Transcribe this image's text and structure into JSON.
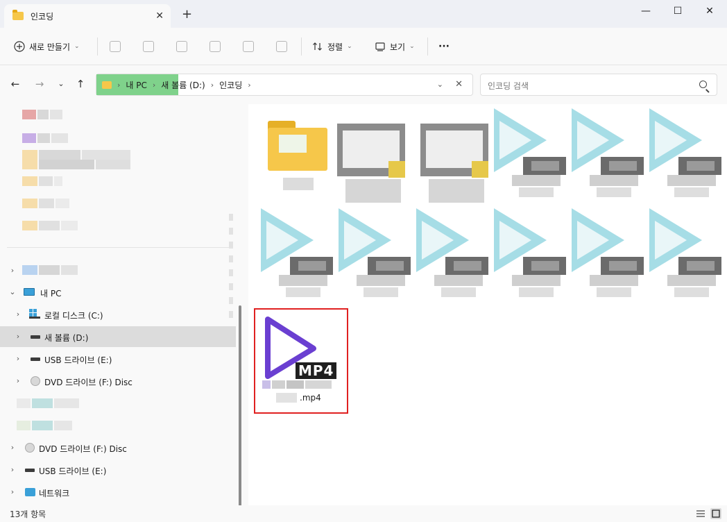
{
  "window": {
    "tab_title": "인코딩",
    "close_tab": "✕",
    "new_tab": "+",
    "minimize": "—",
    "maximize": "☐",
    "close": "✕"
  },
  "toolbar": {
    "new_label": "새로 만들기",
    "sort_label": "정렬",
    "view_label": "보기",
    "more_label": "···"
  },
  "address": {
    "crumbs": [
      "내 PC",
      "새 볼륨 (D:)",
      "인코딩"
    ],
    "separator": "›",
    "search_placeholder": "인코딩 검색"
  },
  "sidebar": {
    "this_pc": "내 PC",
    "drives": [
      {
        "label": "로컬 디스크 (C:)",
        "icon": "windows-drive-icon"
      },
      {
        "label": "새 볼륨 (D:)",
        "icon": "drive-icon",
        "selected": true
      },
      {
        "label": "USB 드라이브 (E:)",
        "icon": "drive-icon"
      },
      {
        "label": "DVD 드라이브 (F:) Disc",
        "icon": "disc-icon"
      }
    ],
    "bottom_items": [
      {
        "label": "DVD 드라이브 (F:) Disc",
        "icon": "disc-icon"
      },
      {
        "label": "USB 드라이브 (E:)",
        "icon": "drive-icon"
      },
      {
        "label": "네트워크",
        "icon": "network-icon"
      }
    ]
  },
  "content": {
    "selected_file_ext": ".mp4",
    "selected_badge": "MP4"
  },
  "status": {
    "item_count": "13개 항목"
  },
  "colors": {
    "accent": "#6a3fd1",
    "selection_outline": "#e02020",
    "address_highlight": "#7fd28b"
  }
}
